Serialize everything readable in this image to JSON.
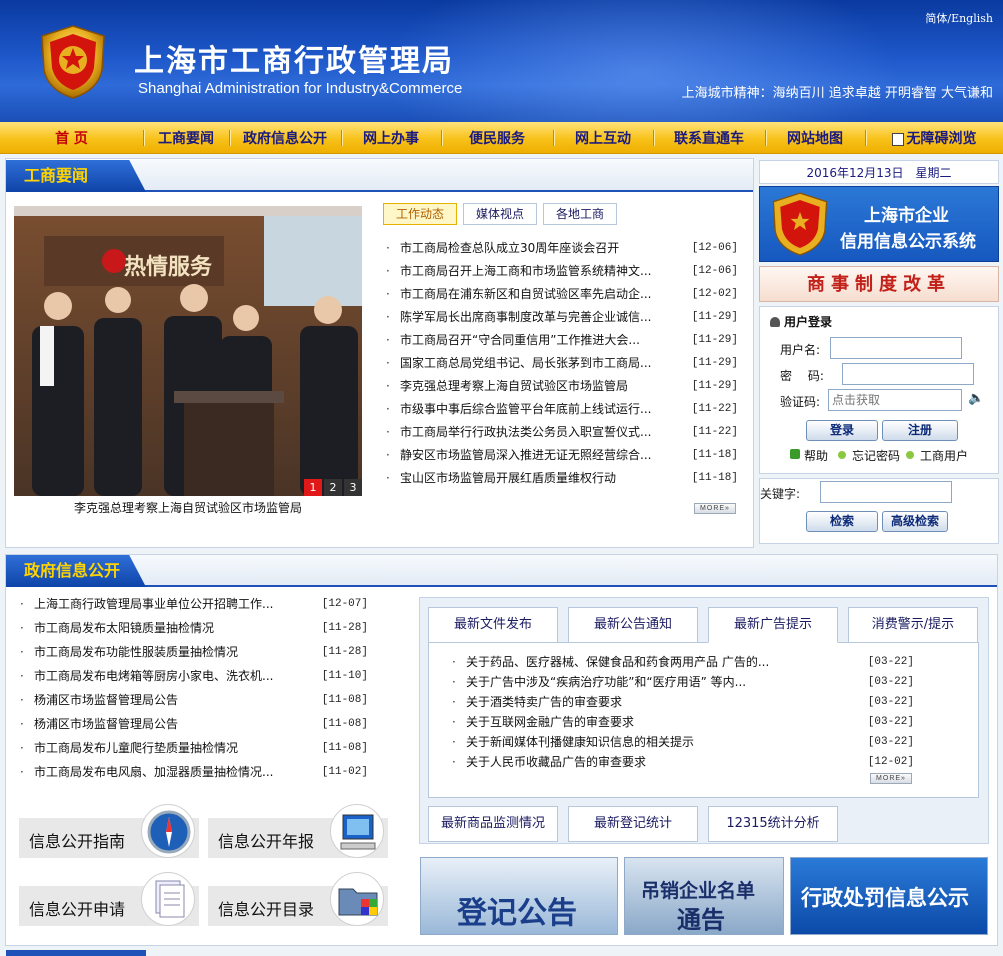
{
  "header": {
    "title": "上海市工商行政管理局",
    "subtitle": "Shanghai Administration for Industry&Commerce",
    "lang_switch": "简体/English",
    "slogan": "上海城市精神：海纳百川 追求卓越 开明睿智 大气谦和"
  },
  "nav": {
    "items": [
      "首 页",
      "工商要闻",
      "政府信息公开",
      "网上办事",
      "便民服务",
      "网上互动",
      "联系直通车",
      "网站地图",
      "无障碍浏览"
    ]
  },
  "news": {
    "section_title": "工商要闻",
    "photo_caption": "李克强总理考察上海自贸试验区市场监管局",
    "photo_sign": "热情服务",
    "pager": [
      "1",
      "2",
      "3"
    ],
    "tabs": [
      "工作动态",
      "媒体视点",
      "各地工商"
    ],
    "items": [
      {
        "title": "市工商局检查总队成立30周年座谈会召开",
        "date": "[12-06]"
      },
      {
        "title": "市工商局召开上海工商和市场监管系统精神文...",
        "date": "[12-06]"
      },
      {
        "title": "市工商局在浦东新区和自贸试验区率先启动企...",
        "date": "[12-02]"
      },
      {
        "title": "陈学军局长出席商事制度改革与完善企业诚信...",
        "date": "[11-29]"
      },
      {
        "title": "市工商局召开“守合同重信用”工作推进大会...",
        "date": "[11-29]"
      },
      {
        "title": "国家工商总局党组书记、局长张茅到市工商局...",
        "date": "[11-29]"
      },
      {
        "title": "李克强总理考察上海自贸试验区市场监管局",
        "date": "[11-29]"
      },
      {
        "title": "市级事中事后综合监管平台年底前上线试运行...",
        "date": "[11-22]"
      },
      {
        "title": "市工商局举行行政执法类公务员入职宣誓仪式...",
        "date": "[11-22]"
      },
      {
        "title": "静安区市场监管局深入推进无证无照经营综合...",
        "date": "[11-18]"
      },
      {
        "title": "宝山区市场监管局开展红盾质量维权行动",
        "date": "[11-18]"
      }
    ],
    "more": "MORE»"
  },
  "sidebar": {
    "date": "2016年12月13日　星期二",
    "credit_banner": [
      "上海市企业",
      "信用信息公示系统"
    ],
    "reform_banner": "商事制度改革",
    "login": {
      "title": "用户登录",
      "username_label": "用户名:",
      "password_label": "密　  码:",
      "captcha_label": "验证码:",
      "captcha_placeholder": "点击获取",
      "login_btn": "登录",
      "register_btn": "注册",
      "help": "帮助",
      "forgot": "忘记密码",
      "user": "工商用户"
    },
    "search": {
      "keyword_label": "关键字:",
      "search_btn": "检索",
      "advanced_btn": "高级检索"
    }
  },
  "gov_info": {
    "section_title": "政府信息公开",
    "items": [
      {
        "title": "上海工商行政管理局事业单位公开招聘工作...",
        "date": "[12-07]"
      },
      {
        "title": "市工商局发布太阳镜质量抽检情况",
        "date": "[11-28]"
      },
      {
        "title": "市工商局发布功能性服装质量抽检情况",
        "date": "[11-28]"
      },
      {
        "title": "市工商局发布电烤箱等厨房小家电、洗衣机...",
        "date": "[11-10]"
      },
      {
        "title": "杨浦区市场监督管理局公告",
        "date": "[11-08]"
      },
      {
        "title": "杨浦区市场监督管理局公告",
        "date": "[11-08]"
      },
      {
        "title": "市工商局发布儿童爬行垫质量抽检情况",
        "date": "[11-08]"
      },
      {
        "title": "市工商局发布电风扇、加湿器质量抽检情况...",
        "date": "[11-02]"
      }
    ],
    "cards": [
      "信息公开指南",
      "信息公开年报",
      "信息公开申请",
      "信息公开目录"
    ]
  },
  "ads": {
    "tabs": [
      "最新文件发布",
      "最新公告通知",
      "最新广告提示",
      "消费警示/提示"
    ],
    "items": [
      {
        "title": "关于药品、医疗器械、保健食品和药食两用产品 广告的...",
        "date": "[03-22]"
      },
      {
        "title": "关于广告中涉及“疾病治疗功能”和“医疗用语” 等内...",
        "date": "[03-22]"
      },
      {
        "title": "关于酒类特卖广告的审查要求",
        "date": "[03-22]"
      },
      {
        "title": "关于互联网金融广告的审查要求",
        "date": "[03-22]"
      },
      {
        "title": "关于新闻媒体刊播健康知识信息的相关提示",
        "date": "[03-22]"
      },
      {
        "title": "关于人民币收藏品广告的审查要求",
        "date": "[12-02]"
      }
    ],
    "more": "MORE»",
    "bottom_tabs": [
      "最新商品监测情况",
      "最新登记统计",
      "12315统计分析"
    ]
  },
  "banners": [
    "登记公告",
    "吊销企业名单",
    "通告",
    "行政处罚信息公示"
  ],
  "colors": {
    "header_blue": "#1d56c8",
    "nav_yellow": "#f8c21a",
    "section_red_text": "#ffd400",
    "accent_red": "#c4000a"
  }
}
